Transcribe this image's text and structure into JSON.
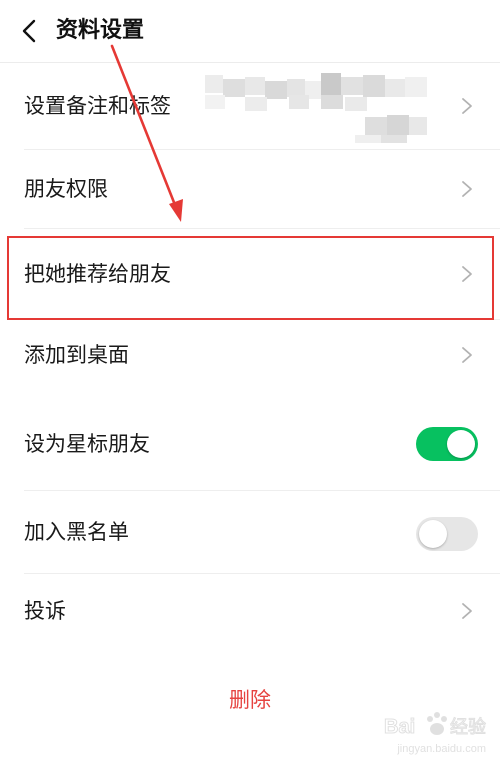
{
  "header": {
    "title": "资料设置",
    "back_icon": "chevron-left-icon"
  },
  "rows": {
    "remark_tags": "设置备注和标签",
    "friend_permissions": "朋友权限",
    "recommend_to_friend": "把她推荐给朋友",
    "add_to_desktop": "添加到桌面",
    "star_friend": "设为星标朋友",
    "blacklist": "加入黑名单",
    "complain": "投诉"
  },
  "toggles": {
    "star_friend_on": true,
    "blacklist_on": false
  },
  "delete": {
    "label": "删除"
  },
  "watermark": {
    "brand": "Bai 经验",
    "url": "jingyan.baidu.com"
  },
  "colors": {
    "toggle_on": "#07c160",
    "toggle_off": "#e6e6e6",
    "delete_text": "#e64340",
    "annotation_red": "#e53935",
    "chevron": "#b2b2b2"
  }
}
